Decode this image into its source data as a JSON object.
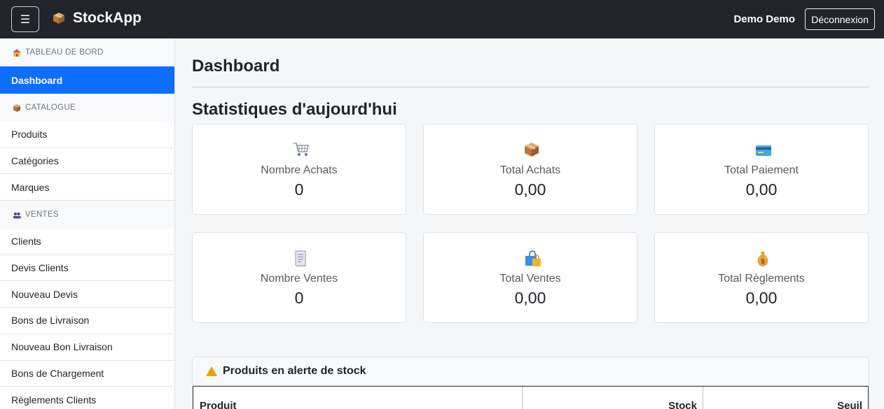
{
  "navbar": {
    "menu_toggle": "☰",
    "brand": "StockApp",
    "user": "Demo Demo",
    "logout": "Déconnexion"
  },
  "sidebar": {
    "sections": [
      {
        "title": "TABLEAU DE BORD",
        "icon": "house-icon",
        "items": [
          {
            "label": "Dashboard",
            "active": true
          }
        ]
      },
      {
        "title": "CATALOGUE",
        "icon": "package-icon",
        "items": [
          {
            "label": "Produits"
          },
          {
            "label": "Catégories"
          },
          {
            "label": "Marques"
          }
        ]
      },
      {
        "title": "VENTES",
        "icon": "users-icon",
        "items": [
          {
            "label": "Clients"
          },
          {
            "label": "Devis Clients"
          },
          {
            "label": "Nouveau Devis"
          },
          {
            "label": "Bons de Livraison"
          },
          {
            "label": "Nouveau Bon Livraison"
          },
          {
            "label": "Bons de Chargement"
          },
          {
            "label": "Règlements Clients"
          }
        ]
      }
    ]
  },
  "main": {
    "title": "Dashboard",
    "stats_title": "Statistiques d'aujourd'hui",
    "cards": [
      {
        "icon": "cart-icon",
        "label": "Nombre Achats",
        "value": "0"
      },
      {
        "icon": "package-icon",
        "label": "Total Achats",
        "value": "0,00"
      },
      {
        "icon": "credit-card-icon",
        "label": "Total Paiement",
        "value": "0,00"
      },
      {
        "icon": "receipt-icon",
        "label": "Nombre Ventes",
        "value": "0"
      },
      {
        "icon": "shopping-bags-icon",
        "label": "Total Ventes",
        "value": "0,00"
      },
      {
        "icon": "money-bag-icon",
        "label": "Total Règlements",
        "value": "0,00"
      }
    ],
    "alert": {
      "title": "Produits en alerte de stock",
      "columns": [
        "Produit",
        "Stock",
        "Seuil"
      ]
    }
  },
  "colors": {
    "navbar": "#212529",
    "accent": "#0d6efd",
    "warning": "#f0a000"
  }
}
